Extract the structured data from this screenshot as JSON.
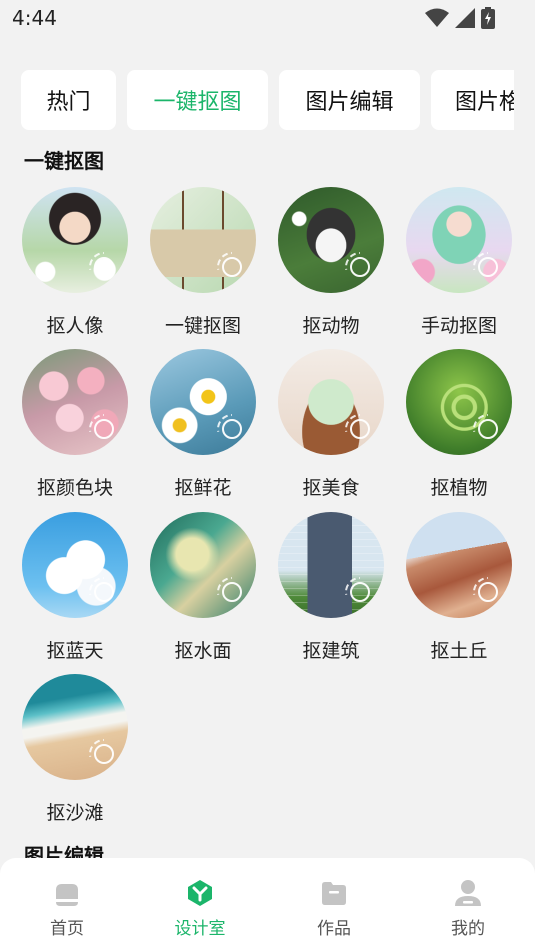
{
  "status_bar": {
    "time": "4:44"
  },
  "tabs": [
    {
      "label": "热门",
      "active": false
    },
    {
      "label": "一键抠图",
      "active": true
    },
    {
      "label": "图片编辑",
      "active": false
    },
    {
      "label": "图片格",
      "active": false
    }
  ],
  "sections": {
    "cutout_title": "一键抠图",
    "edit_title": "图片编辑"
  },
  "cutout_items": [
    {
      "label": "抠人像",
      "icon": "portrait-thumb"
    },
    {
      "label": "一键抠图",
      "icon": "handbag-thumb"
    },
    {
      "label": "抠动物",
      "icon": "husky-thumb"
    },
    {
      "label": "手动抠图",
      "icon": "anime-girl-thumb"
    },
    {
      "label": "抠颜色块",
      "icon": "pink-blossom-thumb"
    },
    {
      "label": "抠鲜花",
      "icon": "daisy-flowers-thumb"
    },
    {
      "label": "抠美食",
      "icon": "cat-dessert-thumb"
    },
    {
      "label": "抠植物",
      "icon": "fern-thumb"
    },
    {
      "label": "抠蓝天",
      "icon": "blue-sky-thumb"
    },
    {
      "label": "抠水面",
      "icon": "water-wave-thumb"
    },
    {
      "label": "抠建筑",
      "icon": "building-thumb"
    },
    {
      "label": "抠土丘",
      "icon": "hills-thumb"
    },
    {
      "label": "抠沙滩",
      "icon": "beach-thumb"
    }
  ],
  "bottom_nav": [
    {
      "label": "首页",
      "icon": "home-icon",
      "active": false
    },
    {
      "label": "设计室",
      "icon": "design-icon",
      "active": true
    },
    {
      "label": "作品",
      "icon": "folder-icon",
      "active": false
    },
    {
      "label": "我的",
      "icon": "user-icon",
      "active": false
    }
  ],
  "colors": {
    "accent": "#1bb56a",
    "background": "#f2f2f2",
    "icon_gray": "#c4c4c4"
  }
}
